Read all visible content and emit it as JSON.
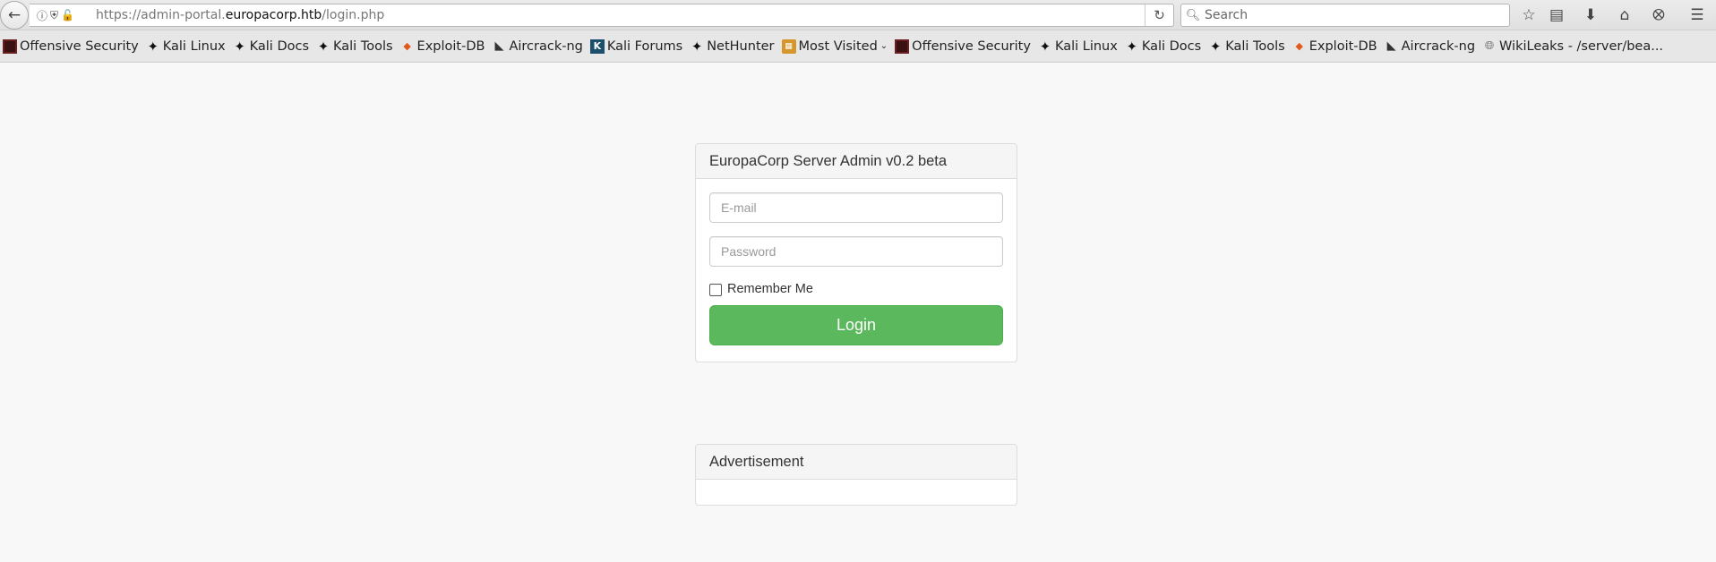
{
  "browser": {
    "url": {
      "prefix": "https://admin-portal.",
      "domain": "europacorp.htb",
      "path": "/login.php"
    },
    "search_placeholder": "Search",
    "icons": [
      "back-arrow-icon",
      "info-icon",
      "shield-icon",
      "insecure-lock-icon",
      "reload-icon",
      "search-icon",
      "star-icon",
      "reading-list-icon",
      "download-icon",
      "home-icon",
      "pocket-icon",
      "menu-icon"
    ]
  },
  "bookmarks": [
    {
      "label": "Offensive Security",
      "icon": "offsec-icon"
    },
    {
      "label": "Kali Linux",
      "icon": "kali-dragon-icon"
    },
    {
      "label": "Kali Docs",
      "icon": "kali-dragon-icon"
    },
    {
      "label": "Kali Tools",
      "icon": "kali-dragon-icon"
    },
    {
      "label": "Exploit-DB",
      "icon": "exploit-db-icon"
    },
    {
      "label": "Aircrack-ng",
      "icon": "aircrack-icon"
    },
    {
      "label": "Kali Forums",
      "icon": "kali-forums-icon"
    },
    {
      "label": "NetHunter",
      "icon": "kali-dragon-icon"
    },
    {
      "label": "Most Visited",
      "icon": "folder-icon"
    },
    {
      "label": "Offensive Security",
      "icon": "offsec-icon"
    },
    {
      "label": "Kali Linux",
      "icon": "kali-dragon-icon"
    },
    {
      "label": "Kali Docs",
      "icon": "kali-dragon-icon"
    },
    {
      "label": "Kali Tools",
      "icon": "kali-dragon-icon"
    },
    {
      "label": "Exploit-DB",
      "icon": "exploit-db-icon"
    },
    {
      "label": "Aircrack-ng",
      "icon": "aircrack-icon"
    },
    {
      "label": "WikiLeaks - /server/bea...",
      "icon": "globe-icon"
    }
  ],
  "login": {
    "title": "EuropaCorp Server Admin v0.2 beta",
    "email_placeholder": "E-mail",
    "password_placeholder": "Password",
    "remember_label": "Remember Me",
    "button_label": "Login",
    "button_color": "#5cb85c"
  },
  "advertisement": {
    "title": "Advertisement"
  }
}
